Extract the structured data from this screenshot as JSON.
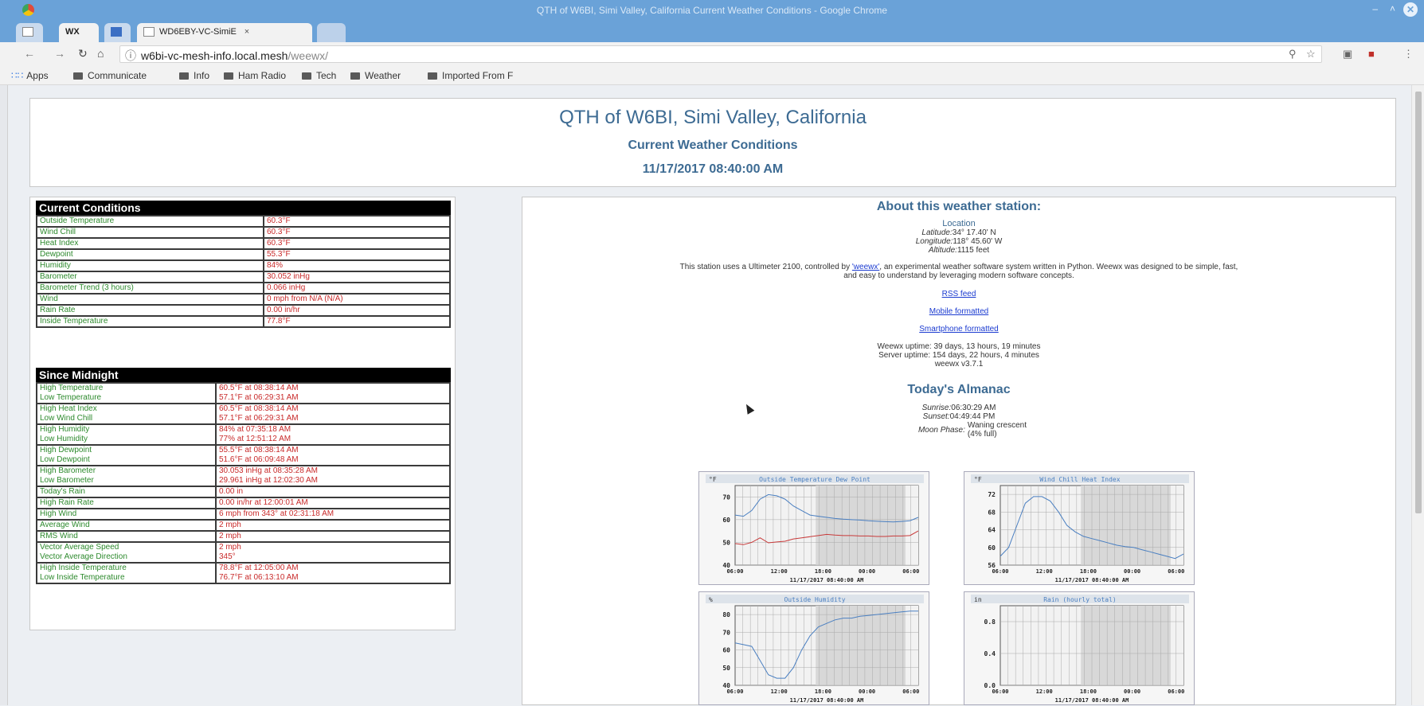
{
  "window": {
    "title": "QTH of W6BI, Simi Valley, California Current Weather Conditions - Google Chrome",
    "min": "–",
    "max": "˄",
    "close": "✕"
  },
  "tabs": [
    {
      "label": "WX"
    },
    {
      "label": "WD6EBY-VC-SimiE",
      "close": "×"
    }
  ],
  "toolbar": {
    "url_host": "w6bi-vc-mesh-info.local.mesh",
    "url_path": "/weewx/",
    "info_icon": "ⓘ"
  },
  "bookmarks": {
    "apps": "Apps",
    "items": [
      "Communicate",
      "Info",
      "Ham Radio",
      "Tech",
      "Weather",
      "Imported From F"
    ]
  },
  "header": {
    "title": "QTH of W6BI, Simi Valley, California",
    "subtitle": "Current Weather Conditions",
    "datetime": "11/17/2017 08:40:00 AM"
  },
  "current": {
    "heading": "Current Conditions",
    "rows": [
      {
        "label": "Outside Temperature",
        "value": "60.3°F"
      },
      {
        "label": "Wind Chill",
        "value": "60.3°F"
      },
      {
        "label": "Heat Index",
        "value": "60.3°F"
      },
      {
        "label": "Dewpoint",
        "value": "55.3°F"
      },
      {
        "label": "Humidity",
        "value": "84%"
      },
      {
        "label": "Barometer",
        "value": "30.052 inHg"
      },
      {
        "label": "Barometer Trend (3 hours)",
        "value": "0.066 inHg"
      },
      {
        "label": "Wind",
        "value": "0 mph from N/A (N/A)"
      },
      {
        "label": "Rain Rate",
        "value": "0.00 in/hr"
      },
      {
        "label": "Inside Temperature",
        "value": "77.8°F"
      }
    ]
  },
  "midnight": {
    "heading": "Since Midnight",
    "rows": [
      {
        "labels": [
          "High Temperature",
          "Low Temperature"
        ],
        "values": [
          "60.5°F at 08:38:14 AM",
          "57.1°F at 06:29:31 AM"
        ]
      },
      {
        "labels": [
          "High Heat Index",
          "Low Wind Chill"
        ],
        "values": [
          "60.5°F at 08:38:14 AM",
          "57.1°F at 06:29:31 AM"
        ]
      },
      {
        "labels": [
          "High Humidity",
          "Low Humidity"
        ],
        "values": [
          "84% at 07:35:18 AM",
          "77% at 12:51:12 AM"
        ]
      },
      {
        "labels": [
          "High Dewpoint",
          "Low Dewpoint"
        ],
        "values": [
          "55.5°F at 08:38:14 AM",
          "51.6°F at 06:09:48 AM"
        ]
      },
      {
        "labels": [
          "High Barometer",
          "Low Barometer"
        ],
        "values": [
          "30.053 inHg at 08:35:28 AM",
          "29.961 inHg at 12:02:30 AM"
        ]
      },
      {
        "labels": [
          "Today's Rain"
        ],
        "values": [
          "0.00 in"
        ]
      },
      {
        "labels": [
          "High Rain Rate"
        ],
        "values": [
          "0.00 in/hr at 12:00:01 AM"
        ]
      },
      {
        "labels": [
          "High Wind"
        ],
        "values": [
          "6 mph from 343° at 02:31:18 AM"
        ]
      },
      {
        "labels": [
          "Average Wind"
        ],
        "values": [
          "2 mph"
        ]
      },
      {
        "labels": [
          "RMS Wind"
        ],
        "values": [
          "2 mph"
        ]
      },
      {
        "labels": [
          "Vector Average Speed",
          "Vector Average Direction"
        ],
        "values": [
          "2 mph",
          "345°"
        ]
      },
      {
        "labels": [
          "High Inside Temperature",
          "Low Inside Temperature"
        ],
        "values": [
          "78.8°F at 12:05:00 AM",
          "76.7°F at 06:13:10 AM"
        ]
      }
    ]
  },
  "about": {
    "heading": "About this weather station:",
    "location_label": "Location",
    "lat_label": "Latitude:",
    "lat": "34° 17.40' N",
    "lon_label": "Longitude:",
    "lon": "118° 45.60' W",
    "alt_label": "Altitude:",
    "alt": "1115 feet",
    "desc_pre": "This station uses a Ultimeter 2100, controlled by ",
    "desc_link": "'weewx'",
    "desc_post": ", an experimental weather software system written in Python. Weewx was designed to be simple, fast,",
    "desc_line2": "and easy to understand by leveraging modern software concepts.",
    "links": [
      "RSS feed",
      "Mobile formatted",
      "Smartphone formatted"
    ],
    "weewx_uptime": "Weewx uptime: 39 days, 13 hours, 19 minutes",
    "server_uptime": "Server uptime: 154 days, 22 hours, 4 minutes",
    "version": "weewx v3.7.1"
  },
  "almanac": {
    "heading": "Today's Almanac",
    "sunrise_label": "Sunrise:",
    "sunrise": "06:30:29 AM",
    "sunset_label": "Sunset:",
    "sunset": "04:49:44 PM",
    "moon_label": "Moon Phase:",
    "moon_line1": "Waning crescent",
    "moon_line2": "(4% full)"
  },
  "plots": [
    {
      "title": "Outside Temperature Dew Point",
      "unit": "°F",
      "xlabel": "11/17/2017 08:40:00 AM",
      "xticks": [
        "06:00",
        "12:00",
        "18:00",
        "00:00",
        "06:00"
      ],
      "yticks": [
        "70",
        "60",
        "50",
        "40"
      ],
      "ylim": [
        40,
        75
      ],
      "series": [
        {
          "color": "#4a7fc1",
          "values": [
            62,
            61.5,
            64,
            69,
            71,
            70.5,
            69,
            66,
            64,
            62,
            61.5,
            61,
            60.5,
            60.2,
            60,
            59.8,
            59.5,
            59.3,
            59.1,
            59,
            59.2,
            59.5,
            61
          ]
        },
        {
          "color": "#c83a3a",
          "values": [
            49.5,
            49,
            50,
            52,
            49.8,
            50.2,
            50.5,
            51.5,
            52,
            52.5,
            53,
            53.5,
            53.2,
            53,
            53,
            52.8,
            52.8,
            52.6,
            52.6,
            52.8,
            52.8,
            53,
            55
          ]
        }
      ]
    },
    {
      "title": "Wind Chill Heat Index",
      "unit": "°F",
      "xlabel": "11/17/2017 08:40:00 AM",
      "xticks": [
        "06:00",
        "12:00",
        "18:00",
        "00:00",
        "06:00"
      ],
      "yticks": [
        "72",
        "68",
        "64",
        "60",
        "56"
      ],
      "ylim": [
        56,
        74
      ],
      "series": [
        {
          "color": "#4a7fc1",
          "values": [
            58,
            60,
            65,
            70,
            71.5,
            71.5,
            70.5,
            68,
            65,
            63.5,
            62.5,
            62,
            61.5,
            61,
            60.5,
            60.2,
            60,
            59.5,
            59,
            58.5,
            58,
            57.5,
            58.5
          ]
        }
      ]
    },
    {
      "title": "Outside Humidity",
      "unit": "%",
      "xlabel": "11/17/2017 08:40:00 AM",
      "xticks": [
        "06:00",
        "12:00",
        "18:00",
        "00:00",
        "06:00"
      ],
      "yticks": [
        "80",
        "70",
        "60",
        "50",
        "40"
      ],
      "ylim": [
        40,
        85
      ],
      "series": [
        {
          "color": "#4a7fc1",
          "values": [
            64,
            63,
            62,
            54,
            46,
            44,
            44,
            50,
            60,
            68,
            73,
            75,
            77,
            78,
            78,
            79,
            79.5,
            80,
            80.5,
            81,
            81.5,
            82,
            82
          ]
        }
      ]
    },
    {
      "title": "Rain (hourly total)",
      "unit": "in",
      "xlabel": "11/17/2017 08:40:00 AM",
      "xticks": [
        "06:00",
        "12:00",
        "18:00",
        "00:00",
        "06:00"
      ],
      "yticks": [
        "0.8",
        "0.4",
        "0.0"
      ],
      "ylim": [
        0,
        1
      ],
      "series": []
    }
  ]
}
